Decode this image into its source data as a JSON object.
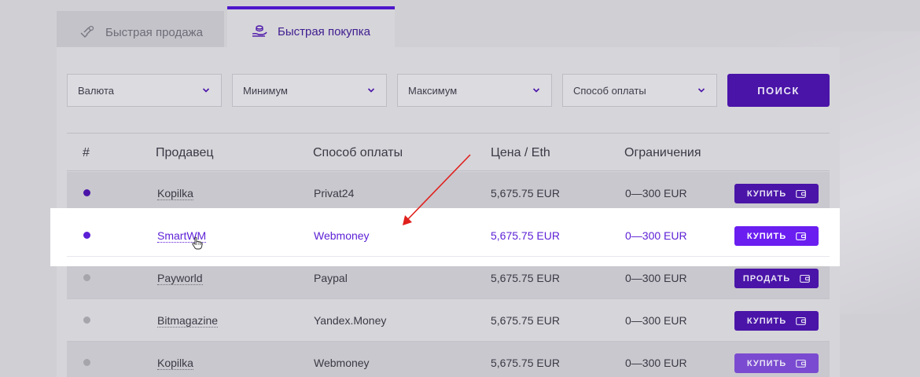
{
  "tabs": [
    {
      "label": "Быстрая продажа",
      "icon": "hand-coins-icon",
      "active": false
    },
    {
      "label": "Быстрая покупка",
      "icon": "coins-hand-icon",
      "active": true
    }
  ],
  "filters": {
    "currency": "Валюта",
    "minimum": "Минимум",
    "maximum": "Максимум",
    "payment_method": "Способ оплаты",
    "search_label": "ПОИСК"
  },
  "table": {
    "headers": [
      "#",
      "Продавец",
      "Способ оплаты",
      "Цена / Eth",
      "Ограничения"
    ],
    "rows": [
      {
        "online": true,
        "seller": "Kopilka",
        "method": "Privat24",
        "price": "5,675.75 EUR",
        "limits": "0—300 EUR",
        "action": "КУПИТЬ"
      },
      {
        "online": true,
        "seller": "SmartWM",
        "method": "Webmoney",
        "price": "5,675.75 EUR",
        "limits": "0—300 EUR",
        "action": "КУПИТЬ"
      },
      {
        "online": false,
        "seller": "Payworld",
        "method": "Paypal",
        "price": "5,675.75 EUR",
        "limits": "0—300 EUR",
        "action": "ПРОДАТЬ"
      },
      {
        "online": false,
        "seller": "Bitmagazine",
        "method": "Yandex.Money",
        "price": "5,675.75 EUR",
        "limits": "0—300 EUR",
        "action": "КУПИТЬ"
      },
      {
        "online": false,
        "seller": "Kopilka",
        "method": "Webmoney",
        "price": "5,675.75 EUR",
        "limits": "0—300 EUR",
        "action": "КУПИТЬ"
      }
    ]
  },
  "colors": {
    "accent": "#4a14a8",
    "highlight_text": "#5b1fd6",
    "annotation_arrow": "#e0201c"
  }
}
